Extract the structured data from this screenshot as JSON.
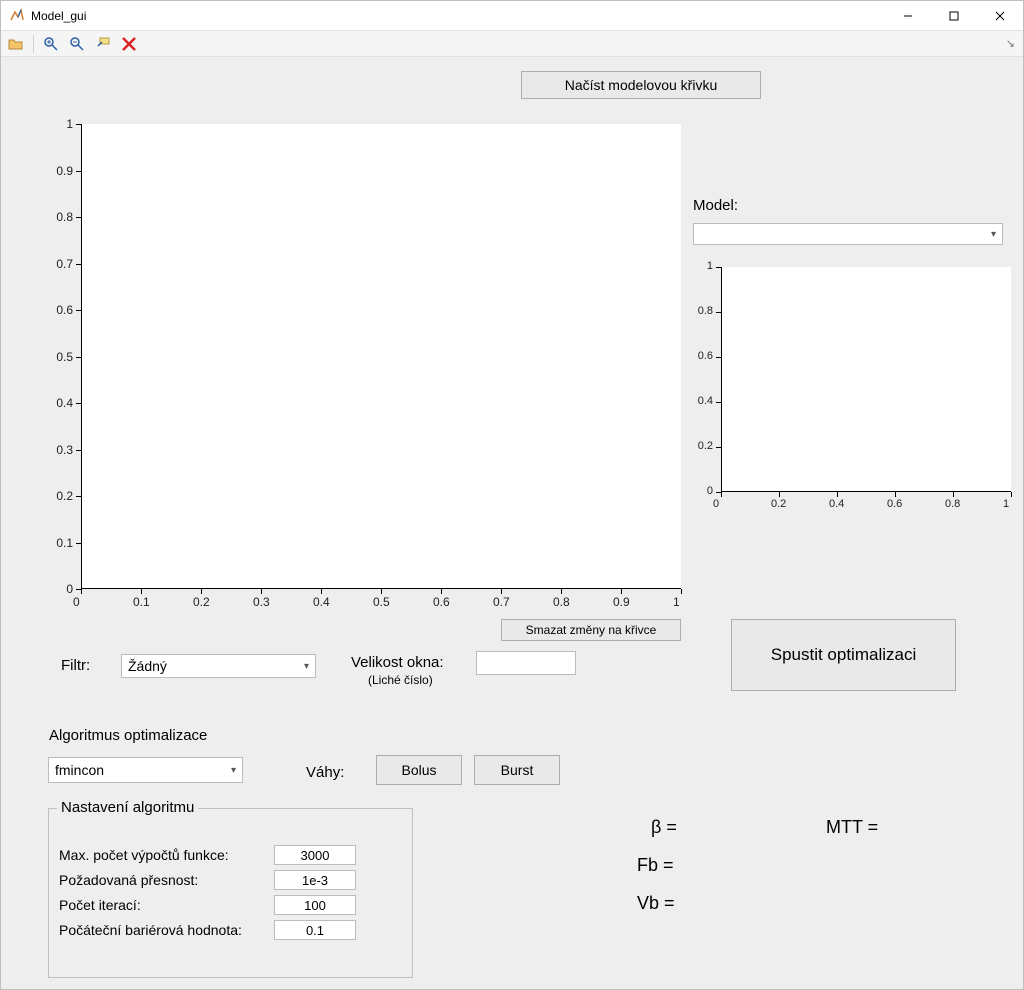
{
  "window": {
    "title": "Model_gui"
  },
  "toolbar_icons": [
    "open-folder-icon",
    "zoom-in-icon",
    "zoom-out-icon",
    "data-cursor-icon",
    "delete-icon"
  ],
  "buttons": {
    "load_model_curve": "Načíst modelovou křivku",
    "clear_curve_changes": "Smazat změny na křivce",
    "run_optimization": "Spustit optimalizaci",
    "bolus": "Bolus",
    "burst": "Burst"
  },
  "labels": {
    "model": "Model:",
    "filter": "Filtr:",
    "window_size": "Velikost okna:",
    "window_size_hint": "(Liché číslo)",
    "opt_algo": "Algoritmus optimalizace",
    "weights": "Váhy:",
    "algo_settings": "Nastavení algoritmu",
    "max_func_evals": "Max. počet výpočtů funkce:",
    "req_accuracy": "Požadovaná přesnost:",
    "num_iter": "Počet iterací:",
    "init_barrier": "Počáteční bariérová hodnota:",
    "beta": "β =",
    "mtt": "MTT =",
    "fb": "Fb =",
    "vb": "Vb ="
  },
  "values": {
    "filter_selected": "Žádný",
    "window_size": "",
    "algo_selected": "fmincon",
    "model_selected": "",
    "max_func_evals": "3000",
    "req_accuracy": "1e-3",
    "num_iter": "100",
    "init_barrier": "0.1"
  },
  "chart_data": [
    {
      "type": "line",
      "series": [],
      "title": "",
      "xlabel": "",
      "ylabel": "",
      "xlim": [
        0,
        1
      ],
      "ylim": [
        0,
        1
      ],
      "xticks": [
        0,
        0.1,
        0.2,
        0.3,
        0.4,
        0.5,
        0.6,
        0.7,
        0.8,
        0.9,
        1
      ],
      "yticks": [
        0,
        0.1,
        0.2,
        0.3,
        0.4,
        0.5,
        0.6,
        0.7,
        0.8,
        0.9,
        1
      ]
    },
    {
      "type": "line",
      "series": [],
      "title": "",
      "xlabel": "",
      "ylabel": "",
      "xlim": [
        0,
        1
      ],
      "ylim": [
        0,
        1
      ],
      "xticks": [
        0,
        0.2,
        0.4,
        0.6,
        0.8,
        1
      ],
      "yticks": [
        0,
        0.2,
        0.4,
        0.6,
        0.8,
        1
      ]
    }
  ]
}
